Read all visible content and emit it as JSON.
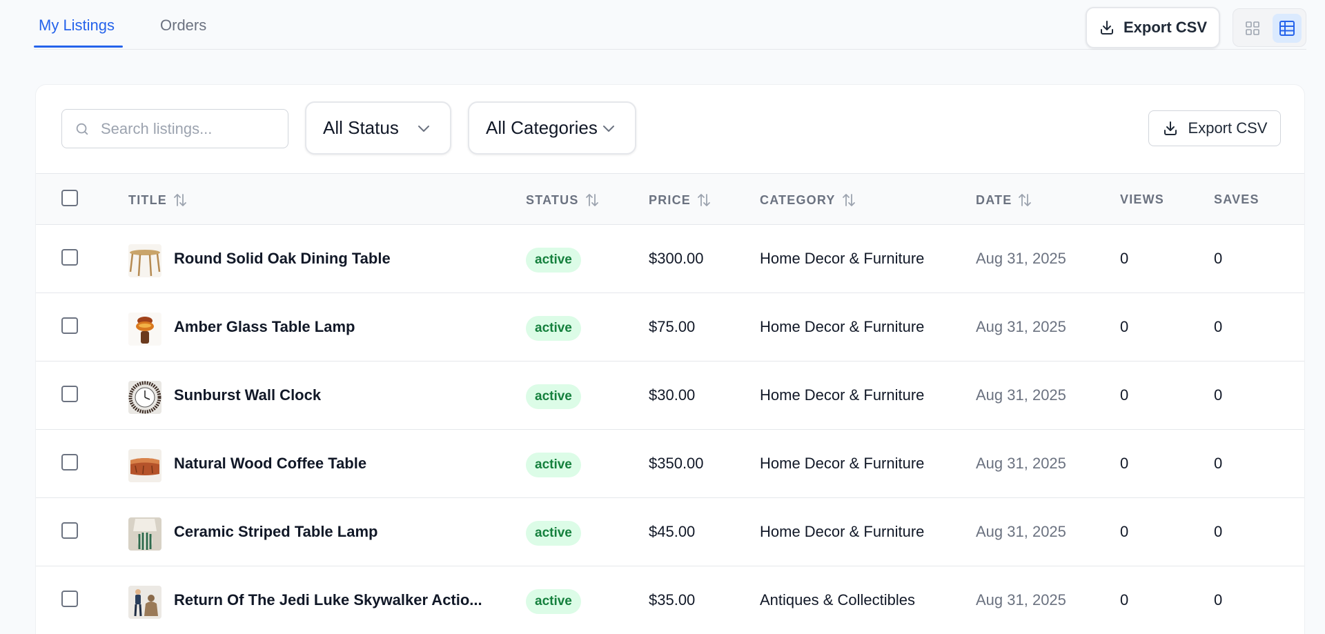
{
  "tabs": {
    "my_listings": "My Listings",
    "orders": "Orders"
  },
  "toolbar": {
    "export_label": "Export CSV"
  },
  "filters": {
    "search_placeholder": "Search listings...",
    "status_selected": "All Status",
    "category_selected": "All Categories",
    "export_label": "Export CSV"
  },
  "table": {
    "headers": {
      "title": "TITLE",
      "status": "STATUS",
      "price": "PRICE",
      "category": "CATEGORY",
      "date": "DATE",
      "views": "VIEWS",
      "saves": "SAVES"
    },
    "rows": [
      {
        "title": "Round Solid Oak Dining Table",
        "status": "active",
        "price": "$300.00",
        "category": "Home Decor & Furniture",
        "date": "Aug 31, 2025",
        "views": "0",
        "saves": "0"
      },
      {
        "title": "Amber Glass Table Lamp",
        "status": "active",
        "price": "$75.00",
        "category": "Home Decor & Furniture",
        "date": "Aug 31, 2025",
        "views": "0",
        "saves": "0"
      },
      {
        "title": "Sunburst Wall Clock",
        "status": "active",
        "price": "$30.00",
        "category": "Home Decor & Furniture",
        "date": "Aug 31, 2025",
        "views": "0",
        "saves": "0"
      },
      {
        "title": "Natural Wood Coffee Table",
        "status": "active",
        "price": "$350.00",
        "category": "Home Decor & Furniture",
        "date": "Aug 31, 2025",
        "views": "0",
        "saves": "0"
      },
      {
        "title": "Ceramic Striped Table Lamp",
        "status": "active",
        "price": "$45.00",
        "category": "Home Decor & Furniture",
        "date": "Aug 31, 2025",
        "views": "0",
        "saves": "0"
      },
      {
        "title": "Return Of The Jedi Luke Skywalker Actio...",
        "status": "active",
        "price": "$35.00",
        "category": "Antiques & Collectibles",
        "date": "Aug 31, 2025",
        "views": "0",
        "saves": "0"
      }
    ]
  },
  "colors": {
    "accent": "#2563eb",
    "status_active_bg": "#dcfce7",
    "status_active_text": "#15803d"
  }
}
